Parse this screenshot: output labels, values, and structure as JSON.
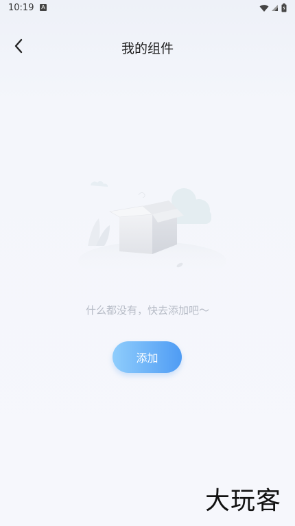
{
  "status_bar": {
    "time": "10:19",
    "notification_icon": "a-icon",
    "icons": [
      "wifi-icon",
      "signal-icon",
      "battery-icon"
    ]
  },
  "header": {
    "back_icon": "chevron-left-icon",
    "title": "我的组件"
  },
  "empty_state": {
    "illustration": "empty-box-illustration",
    "message": "什么都没有，快去添加吧～"
  },
  "actions": {
    "add_label": "添加"
  },
  "watermark": {
    "text": "大玩客"
  },
  "colors": {
    "accent_start": "#8fcdfc",
    "accent_end": "#4f9cf4",
    "muted_text": "#b6bbc6"
  }
}
